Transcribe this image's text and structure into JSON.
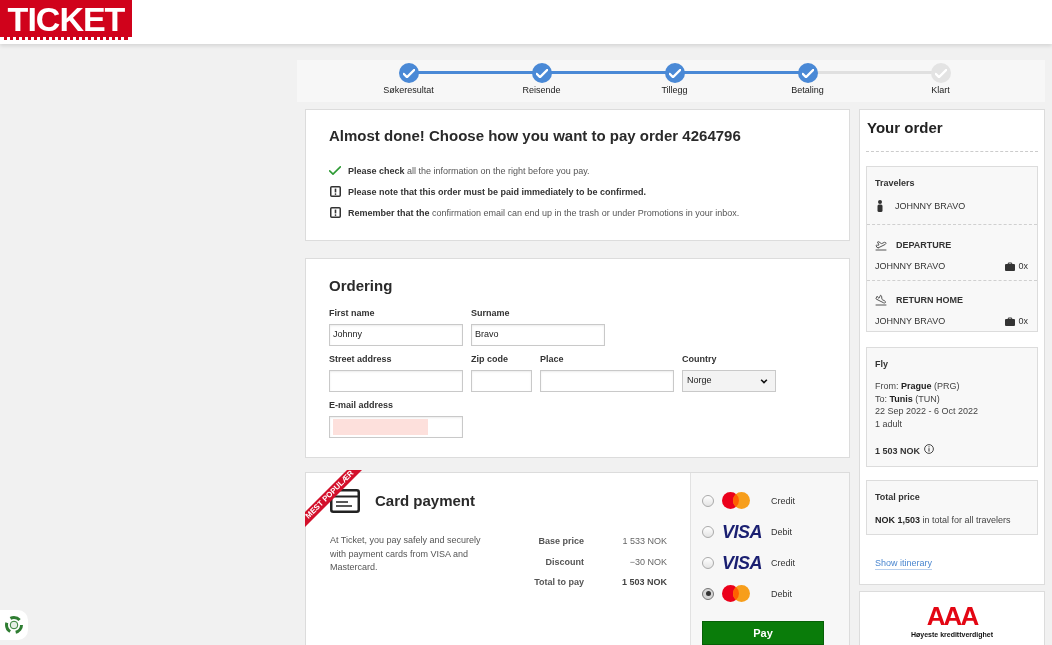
{
  "header": {
    "logo": "TICKET"
  },
  "progress": {
    "steps": [
      {
        "label": "Søkeresultat",
        "done": true
      },
      {
        "label": "Reisende",
        "done": true
      },
      {
        "label": "Tillegg",
        "done": true
      },
      {
        "label": "Betaling",
        "done": true
      },
      {
        "label": "Klart",
        "done": false
      }
    ]
  },
  "notice": {
    "title": "Almost done! Choose how you want to pay order 4264796",
    "notes": [
      {
        "kind": "check",
        "bold": false,
        "text": "**Please check** all the information on the right before you pay."
      },
      {
        "kind": "warning",
        "bold": true,
        "text": "Please note that this order must be paid immediately to be confirmed."
      },
      {
        "kind": "warning",
        "bold": false,
        "text": "**Remember that the** confirmation email can end up in the trash or under Promotions in your inbox."
      }
    ]
  },
  "ordering": {
    "title": "Ordering",
    "rows": [
      [
        {
          "kind": "text",
          "label": "First name",
          "value": "Johnny",
          "redacted": false
        },
        {
          "kind": "text",
          "label": "Surname",
          "value": "Bravo",
          "redacted": false
        }
      ],
      [
        {
          "kind": "text",
          "label": "Street address",
          "redacted": false
        },
        {
          "kind": "zip",
          "label": "Zip code",
          "redacted": false
        },
        {
          "kind": "text",
          "label": "Place",
          "redacted": false
        },
        {
          "kind": "select",
          "label": "Country",
          "value": "Norge",
          "redacted": false
        }
      ],
      [
        {
          "kind": "email",
          "label": "E-mail address",
          "redacted": true
        }
      ]
    ]
  },
  "payment": {
    "ribbon": "MEST POPULÆR",
    "title": "Card payment",
    "description": "At Ticket, you pay safely and securely with payment cards from VISA and Mastercard.",
    "price_rows": [
      {
        "label": "Base price",
        "value": "1 533 NOK",
        "total": false
      },
      {
        "label": "Discount",
        "value": "−30 NOK",
        "total": false
      },
      {
        "label": "Total to pay",
        "value": "1 503 NOK",
        "total": true
      }
    ],
    "options": [
      {
        "kind": "mastercard",
        "type": "Credit",
        "selected": false
      },
      {
        "kind": "visa",
        "logo": "VISA",
        "type": "Debit",
        "selected": false
      },
      {
        "kind": "visa",
        "logo": "VISA",
        "type": "Credit",
        "selected": false
      },
      {
        "kind": "mastercard",
        "type": "Debit",
        "selected": true
      }
    ],
    "pay_button": "Pay"
  },
  "order": {
    "title": "Your order",
    "travelers": {
      "heading": "Travelers",
      "names": [
        "JOHNNY BRAVO"
      ]
    },
    "legs": [
      {
        "kind": "departure",
        "title": "DEPARTURE",
        "traveler": "JOHNNY BRAVO",
        "bags": "0x"
      },
      {
        "kind": "return",
        "title": "RETURN HOME",
        "traveler": "JOHNNY BRAVO",
        "bags": "0x"
      }
    ],
    "flight": {
      "heading": "Fly",
      "lines": [
        "From: **Prague** (PRG)",
        "To: **Tunis** (TUN)",
        "22 Sep 2022 - 6 Oct 2022",
        "1 adult"
      ],
      "price": "1 503 NOK"
    },
    "total": {
      "heading": "Total price",
      "text": "**NOK 1,503** in total for all travelers"
    },
    "link": "Show itinerary"
  },
  "rating": {
    "logo": "AAA",
    "caption": "Høyeste kredittverdighet"
  }
}
